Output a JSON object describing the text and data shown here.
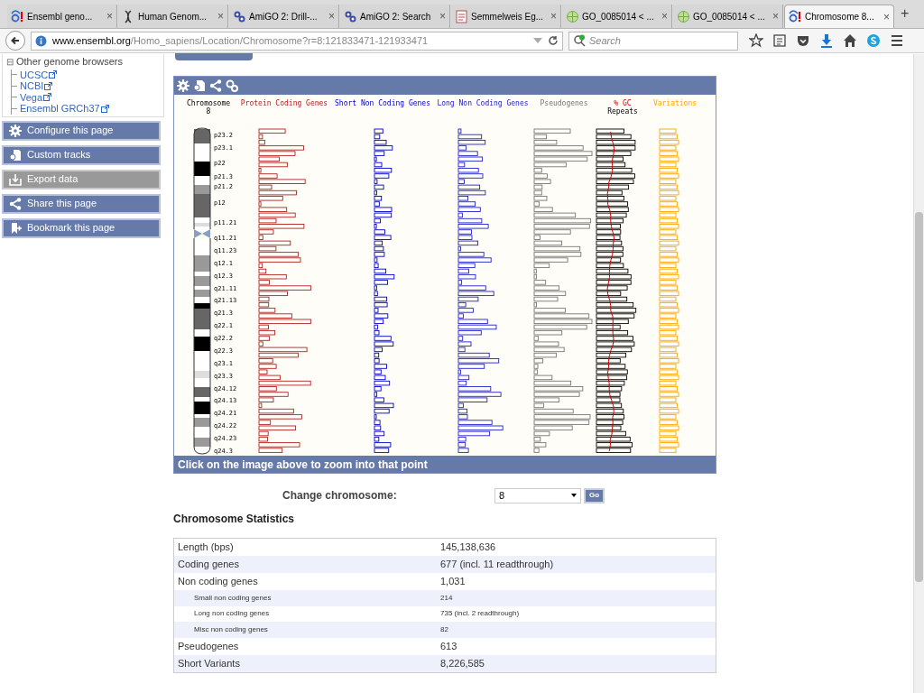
{
  "browser": {
    "tabs": [
      {
        "label": "Ensembl geno...",
        "close": "×",
        "selected": false
      },
      {
        "label": "Human Genom...",
        "close": "×",
        "selected": false
      },
      {
        "label": "AmiGO 2: Drill-...",
        "close": "×",
        "selected": false
      },
      {
        "label": "AmiGO 2: Search",
        "close": "×",
        "selected": false
      },
      {
        "label": "Semmelweis Eg...",
        "close": "×",
        "selected": false
      },
      {
        "label": "GO_0085014 < ...",
        "close": "×",
        "selected": false
      },
      {
        "label": "GO_0085014 < ...",
        "close": "×",
        "selected": false
      },
      {
        "label": "Chromosome 8...",
        "close": "×",
        "selected": true
      }
    ],
    "new_tab": "+",
    "address": {
      "domain": "www.ensembl.org",
      "path": "/Homo_sapiens/Location/Chromosome?r=8:121833471-121933471"
    },
    "search": {
      "placeholder": "Search"
    }
  },
  "sidebar": {
    "tree": {
      "label": "Other genome browsers",
      "expanded": true,
      "expander": "⊟",
      "children": [
        {
          "label": "UCSC"
        },
        {
          "label": "NCBI"
        },
        {
          "label": "Vega"
        },
        {
          "label": "Ensembl GRCh37"
        }
      ]
    },
    "buttons": [
      {
        "label": "Configure this page",
        "disabled": false
      },
      {
        "label": "Custom tracks",
        "disabled": false
      },
      {
        "label": "Export data",
        "disabled": true
      },
      {
        "label": "Share this page",
        "disabled": false
      },
      {
        "label": "Bookmark this page",
        "disabled": false
      }
    ]
  },
  "panel": {
    "tracks": [
      {
        "label": "Chromosome",
        "sub": "8",
        "kind": "ideogram"
      },
      {
        "label": "Protein Coding Genes",
        "kind": "protein"
      },
      {
        "label": "Short Non Coding Genes",
        "kind": "short"
      },
      {
        "label": "Long Non Coding Genes",
        "kind": "long"
      },
      {
        "label": "Pseudogenes",
        "kind": "pseudo"
      },
      {
        "label": "% GC",
        "sub": "Repeats",
        "kind": "gc"
      },
      {
        "label": "Variations",
        "kind": "variation"
      }
    ],
    "bands": [
      "p23.2",
      "p23.1",
      "p22",
      "p21.3",
      "p21.2",
      "p12",
      "p11.21",
      "q11.21",
      "q11.23",
      "q12.1",
      "q12.3",
      "q21.11",
      "q21.13",
      "q21.3",
      "q22.1",
      "q22.2",
      "q22.3",
      "q23.1",
      "q23.3",
      "q24.12",
      "q24.13",
      "q24.21",
      "q24.22",
      "q24.23",
      "q24.3"
    ],
    "caption": "Click on the image above to zoom into that point"
  },
  "change": {
    "label": "Change chromosome:",
    "value": "8",
    "button": "Go"
  },
  "statistics": {
    "title": "Chromosome Statistics",
    "rows": [
      {
        "label": "Length (bps)",
        "value": "145,138,636",
        "kind": "main"
      },
      {
        "label": "Coding genes",
        "value": "677 (incl. 11 readthrough)",
        "kind": "main"
      },
      {
        "label": "Non coding genes",
        "value": "1,031",
        "kind": "main"
      },
      {
        "label": "Small non coding genes",
        "value": "214",
        "kind": "sub"
      },
      {
        "label": "Long non coding genes",
        "value": "735 (incl. 2 readthrough)",
        "kind": "sub"
      },
      {
        "label": "Misc non coding genes",
        "value": "82",
        "kind": "sub"
      },
      {
        "label": "Pseudogenes",
        "value": "613",
        "kind": "main"
      },
      {
        "label": "Short Variants",
        "value": "8,226,585",
        "kind": "main"
      }
    ]
  }
}
